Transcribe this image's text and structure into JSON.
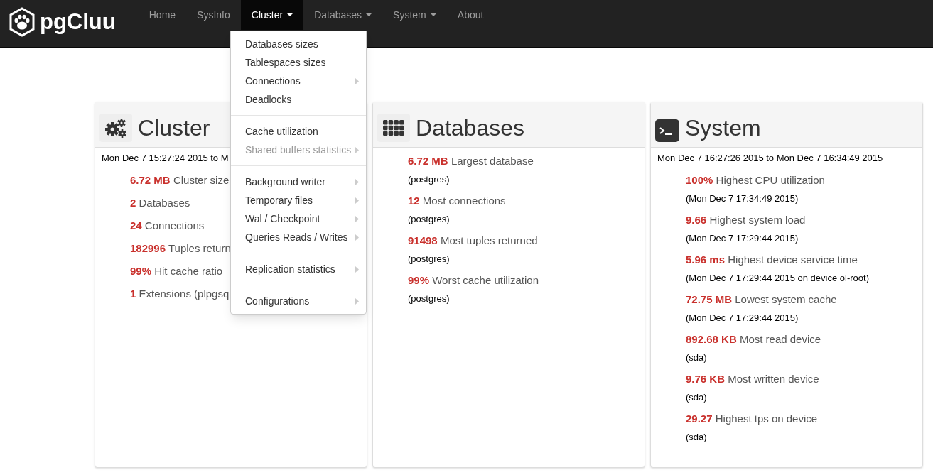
{
  "brand": "pgCluu",
  "nav": [
    {
      "label": "Home",
      "dropdown": false,
      "selected": false
    },
    {
      "label": "SysInfo",
      "dropdown": false,
      "selected": false
    },
    {
      "label": "Cluster",
      "dropdown": true,
      "selected": true
    },
    {
      "label": "Databases",
      "dropdown": true,
      "selected": false
    },
    {
      "label": "System",
      "dropdown": true,
      "selected": false
    },
    {
      "label": "About",
      "dropdown": false,
      "selected": false
    }
  ],
  "menu": [
    [
      {
        "label": "Databases sizes",
        "submenu": false,
        "disabled": false
      },
      {
        "label": "Tablespaces sizes",
        "submenu": false,
        "disabled": false
      },
      {
        "label": "Connections",
        "submenu": true,
        "disabled": false
      },
      {
        "label": "Deadlocks",
        "submenu": false,
        "disabled": false
      }
    ],
    [
      {
        "label": "Cache utilization",
        "submenu": false,
        "disabled": false
      },
      {
        "label": "Shared buffers statistics",
        "submenu": true,
        "disabled": true
      }
    ],
    [
      {
        "label": "Background writer",
        "submenu": true,
        "disabled": false
      },
      {
        "label": "Temporary files",
        "submenu": true,
        "disabled": false
      },
      {
        "label": "Wal / Checkpoint",
        "submenu": true,
        "disabled": false
      },
      {
        "label": "Queries Reads / Writes",
        "submenu": true,
        "disabled": false
      }
    ],
    [
      {
        "label": "Replication statistics",
        "submenu": true,
        "disabled": false
      }
    ],
    [
      {
        "label": "Configurations",
        "submenu": true,
        "disabled": false
      }
    ]
  ],
  "panels": [
    {
      "kind": "gears",
      "title": "Cluster",
      "period": "Mon Dec 7 15:27:24 2015 to M",
      "stats": [
        {
          "value": "6.72 MB",
          "label": "Cluster size"
        },
        {
          "value": "2",
          "label": "Databases"
        },
        {
          "value": "24",
          "label": "Connections"
        },
        {
          "value": "182996",
          "label": "Tuples return"
        },
        {
          "value": "99%",
          "label": "Hit cache ratio"
        },
        {
          "value": "1",
          "label": "Extensions (plpgsql"
        }
      ]
    },
    {
      "kind": "grid",
      "title": "Databases",
      "stats": [
        {
          "value": "6.72 MB",
          "label": "Largest database",
          "detail": "(postgres)"
        },
        {
          "value": "12",
          "label": "Most connections",
          "detail": "(postgres)"
        },
        {
          "value": "91498",
          "label": "Most tuples returned",
          "detail": "(postgres)"
        },
        {
          "value": "99%",
          "label": "Worst cache utilization",
          "detail": "(postgres)"
        }
      ]
    },
    {
      "kind": "terminal",
      "title": "System",
      "period": "Mon Dec 7 16:27:26 2015 to Mon Dec 7 16:34:49 2015",
      "stats": [
        {
          "value": "100%",
          "label": "Highest CPU utilization",
          "detail": "(Mon Dec 7 17:34:49 2015)"
        },
        {
          "value": "9.66",
          "label": "Highest system load",
          "detail": "(Mon Dec 7 17:29:44 2015)"
        },
        {
          "value": "5.96 ms",
          "label": "Highest device service time",
          "detail": "(Mon Dec 7 17:29:44 2015 on device ol-root)"
        },
        {
          "value": "72.75 MB",
          "label": "Lowest system cache",
          "detail": "(Mon Dec 7 17:29:44 2015)"
        },
        {
          "value": "892.68 KB",
          "label": "Most read device",
          "detail": "(sda)"
        },
        {
          "value": "9.76 KB",
          "label": "Most written device",
          "detail": "(sda)"
        },
        {
          "value": "29.27",
          "label": "Highest tps on device",
          "detail": "(sda)"
        }
      ]
    }
  ]
}
